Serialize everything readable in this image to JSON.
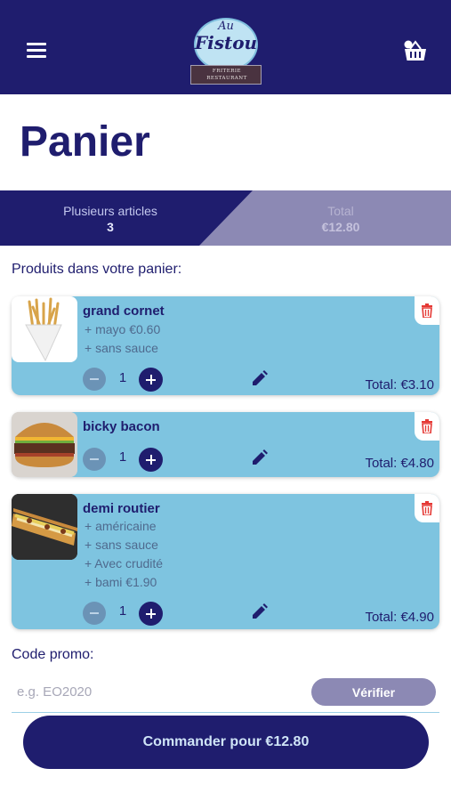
{
  "header": {
    "menu_icon": "hamburger-menu-icon",
    "cart_icon": "basket-icon",
    "logo": {
      "top_text": "Au",
      "name": "Fistou",
      "subtitle_line1": "FRITERIE",
      "subtitle_line2": "RESTAURANT"
    }
  },
  "page": {
    "title": "Panier"
  },
  "summary": {
    "articles_label": "Plusieurs articles",
    "articles_count": "3",
    "total_label": "Total",
    "total_value": "€12.80"
  },
  "cart": {
    "heading": "Produits dans votre panier:",
    "items": [
      {
        "name": "grand cornet",
        "options": [
          "+ mayo €0.60",
          "+ sans sauce"
        ],
        "quantity": "1",
        "total": "Total: €3.10",
        "image": "fries-cone"
      },
      {
        "name": "bicky bacon",
        "options": [],
        "quantity": "1",
        "total": "Total: €4.80",
        "image": "burger"
      },
      {
        "name": "demi routier",
        "options": [
          "+ américaine",
          "+ sans sauce",
          "+ Avec crudité",
          "+ bami €1.90"
        ],
        "quantity": "1",
        "total": "Total: €4.90",
        "image": "sandwich"
      }
    ]
  },
  "promo": {
    "label": "Code promo:",
    "placeholder": "e.g. EO2020",
    "value": "",
    "verify_label": "Vérifier"
  },
  "checkout": {
    "order_label": "Commander pour €12.80"
  },
  "colors": {
    "primary": "#1f1d6e",
    "card": "#7ec4e0",
    "muted": "#8c89b4",
    "delete": "#e53935"
  }
}
